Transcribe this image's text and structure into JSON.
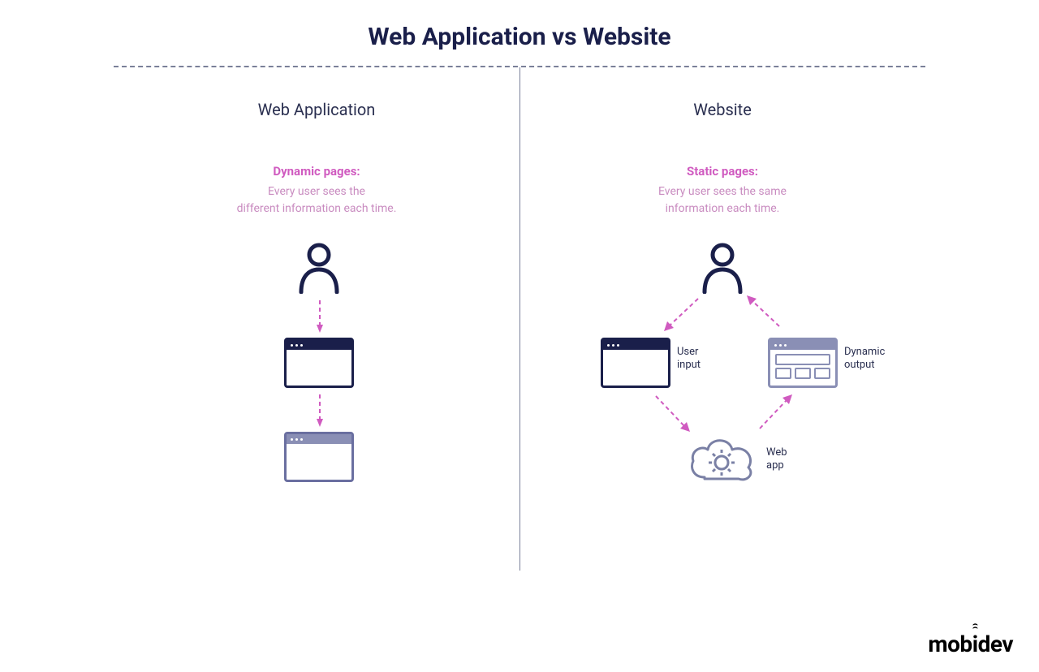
{
  "title": "Web Application vs Website",
  "left": {
    "heading": "Web Application",
    "pages_label": "Dynamic pages:",
    "pages_desc": "Every user sees the\ndifferent information each time."
  },
  "right": {
    "heading": "Website",
    "pages_label": "Static pages:",
    "pages_desc": "Every user sees the same\ninformation each time.",
    "labels": {
      "user_input": "User\ninput",
      "dynamic_output": "Dynamic\noutput",
      "web_app": "Web\napp"
    }
  },
  "logo": "mobidev",
  "colors": {
    "title": "#1a1f4a",
    "magenta": "#d05bc0",
    "magenta_light": "#c98cc0",
    "icon_dark": "#1a1f4a",
    "icon_muted": "#6a6fa0"
  }
}
